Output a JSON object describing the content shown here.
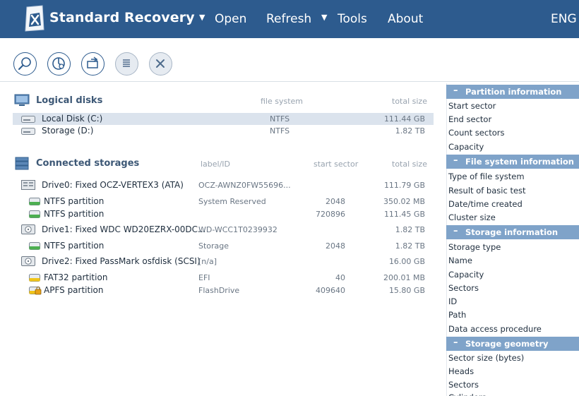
{
  "app": {
    "title": "Standard Recovery"
  },
  "menu": {
    "open": "Open",
    "refresh": "Refresh",
    "tools": "Tools",
    "about": "About",
    "language": "ENG"
  },
  "icons": {
    "logo": "app-logo-icon",
    "toolbar": [
      "search-icon",
      "pie-chart-icon",
      "export-icon",
      "list-icon",
      "close-icon"
    ]
  },
  "logical": {
    "title": "Logical disks",
    "col_fs": "file system",
    "col_size": "total size",
    "rows": [
      {
        "name": "Local Disk (C:)",
        "fs": "NTFS",
        "size": "111.44 GB",
        "selected": true
      },
      {
        "name": "Storage (D:)",
        "fs": "NTFS",
        "size": "1.82 TB",
        "selected": false
      }
    ]
  },
  "connected": {
    "title": "Connected storages",
    "col_label": "label/ID",
    "col_start": "start sector",
    "col_size": "total size",
    "rows": [
      {
        "type": "drive",
        "name": "Drive0: Fixed OCZ-VERTEX3 (ATA)",
        "label": "OCZ-AWNZ0FW55696...",
        "start": "",
        "size": "111.79 GB"
      },
      {
        "type": "partition",
        "name": "NTFS partition",
        "label": "System Reserved",
        "start": "2048",
        "size": "350.02 MB"
      },
      {
        "type": "partition",
        "name": "NTFS partition",
        "label": "",
        "start": "720896",
        "size": "111.45 GB"
      },
      {
        "type": "drive",
        "name": "Drive1: Fixed WDC WD20EZRX-00DC...",
        "label": "WD-WCC1T0239932",
        "start": "",
        "size": "1.82 TB"
      },
      {
        "type": "partition",
        "name": "NTFS partition",
        "label": "Storage",
        "start": "2048",
        "size": "1.82 TB"
      },
      {
        "type": "drive",
        "name": "Drive2: Fixed PassMark osfdisk (SCSI)",
        "label": "[n/a]",
        "start": "",
        "size": "16.00 GB"
      },
      {
        "type": "partition",
        "name": "FAT32 partition",
        "label": "EFI",
        "start": "40",
        "size": "200.01 MB"
      },
      {
        "type": "partition-locked",
        "name": "APFS partition",
        "label": "FlashDrive",
        "start": "409640",
        "size": "15.80 GB"
      }
    ]
  },
  "info": {
    "partition": {
      "title": "Partition information",
      "items": [
        "Start sector",
        "End sector",
        "Count sectors",
        "Capacity"
      ]
    },
    "filesystem": {
      "title": "File system information",
      "items": [
        "Type of file system",
        "Result of basic test",
        "Date/time created",
        "Cluster size"
      ]
    },
    "storage": {
      "title": "Storage information",
      "items": [
        "Storage type",
        "Name",
        "Capacity",
        "Sectors",
        "ID",
        "Path",
        "Data access procedure"
      ]
    },
    "geometry": {
      "title": "Storage geometry",
      "items": [
        "Sector size (bytes)",
        "Heads",
        "Sectors",
        "Cylinders"
      ]
    }
  },
  "colors": {
    "header_bg": "#2d5b8e",
    "panel_header_bg": "#7fa3c9",
    "selected_row": "#dbe3ed",
    "section_title": "#3d5876"
  }
}
